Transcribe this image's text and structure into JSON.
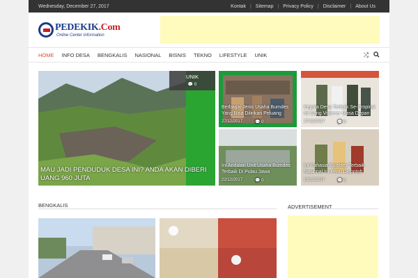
{
  "topbar": {
    "date": "Wednesday, December 27, 2017",
    "links": [
      "Kontak",
      "Sitemap",
      "Privacy Policy",
      "Disclaimer",
      "About Us"
    ]
  },
  "logo": {
    "name": "PEDEKIK",
    "suffix": ".Com",
    "tagline": "Online Center Information"
  },
  "nav": {
    "items": [
      "HOME",
      "INFO DESA",
      "BENGKALIS",
      "NASIONAL",
      "BISNIS",
      "TEKNO",
      "LIFESTYLE",
      "UNIK"
    ],
    "active_index": 0
  },
  "featured": {
    "main": {
      "category": "UNIK",
      "comments": "0",
      "title": "MAU JADI PENDUDUK DESA INI? ANDA AKAN DIBERI UANG 960 JUTA"
    },
    "tiles": [
      {
        "title": "Berbagai Jenis Usaha Bumdes Yang Bisa Dilirikan Peluang",
        "date": "27/12/2017",
        "comments": "0"
      },
      {
        "title": "Kepala Desa Terbaik Se-Propinsi Ini Sang Visioner Masa Depan",
        "date": "27/12/2017",
        "comments": "0"
      },
      {
        "title": "Ini Andalan Unit Usaha Bumdes Terbaik Di Pulau Jawa",
        "date": "22/12/2017",
        "comments": "0"
      },
      {
        "title": "Ini Rahasia Bumdes Terbaik Nasional Ini Perlu Dicontoh",
        "date": "16/12/2017",
        "comments": "0"
      }
    ]
  },
  "sections": {
    "bengkalis": "BENGKALIS",
    "advertisement": "ADVERTISEMENT"
  },
  "colors": {
    "accent": "#e24a2b",
    "ad_bg": "#fffbbd",
    "topbar": "#333333"
  }
}
